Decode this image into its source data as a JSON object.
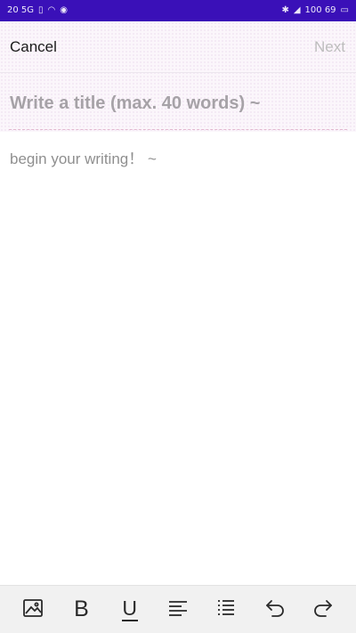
{
  "status_bar": {
    "left_text": "20 5G",
    "right_text": "100 69"
  },
  "header": {
    "cancel_label": "Cancel",
    "next_label": "Next"
  },
  "title_field": {
    "value": "",
    "placeholder": "Write a title (max. 40 words) ~"
  },
  "body_field": {
    "value": "",
    "placeholder": "begin your writing！ ~"
  },
  "toolbar": {
    "bold_label": "B",
    "underline_label": "U",
    "icons": [
      "image-icon",
      "bold-icon",
      "underline-icon",
      "align-left-icon",
      "numbered-list-icon",
      "undo-icon",
      "redo-icon"
    ]
  },
  "colors": {
    "status_bar": "#3a10b8",
    "cancel_text": "#1b1b1b",
    "next_text_disabled": "#bdbdbd",
    "placeholder_text": "#a6a2a7",
    "divider_dash": "#e3b9d0",
    "toolbar_bg": "#f1f1f1"
  }
}
